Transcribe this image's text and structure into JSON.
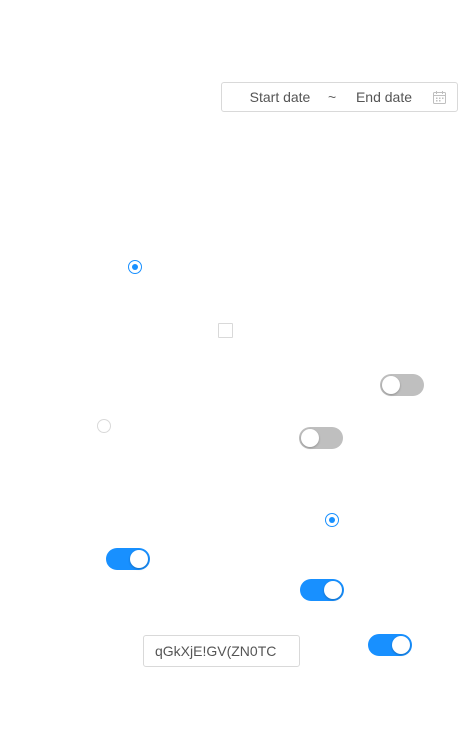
{
  "date_range": {
    "start_placeholder": "Start date",
    "separator": "~",
    "end_placeholder": "End date",
    "icon": "calendar-icon"
  },
  "text_input": {
    "value": "qGkXjE!GV(ZN0TC"
  },
  "radios": [
    {
      "checked": true
    },
    {
      "checked": false
    },
    {
      "checked": true
    }
  ],
  "checkboxes": [
    {
      "checked": false
    }
  ],
  "switches": [
    {
      "on": false
    },
    {
      "on": false
    },
    {
      "on": true
    },
    {
      "on": true
    },
    {
      "on": true
    }
  ],
  "colors": {
    "accent": "#1890ff",
    "switch_off": "#bfbfbf",
    "border": "#d9d9d9"
  }
}
